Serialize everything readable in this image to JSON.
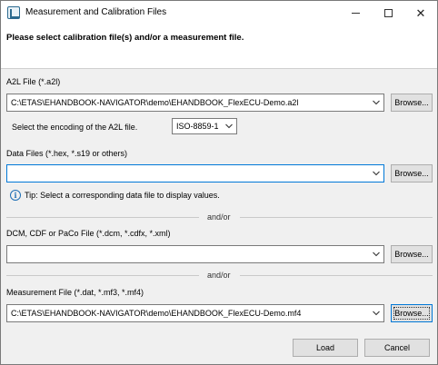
{
  "window": {
    "title": "Measurement and Calibration Files",
    "minimize_label": "",
    "maximize_label": "",
    "close_label": ""
  },
  "header": {
    "instruction": "Please select calibration file(s) and/or a measurement file."
  },
  "a2l": {
    "label": "A2L File (*.a2l)",
    "value": "C:\\ETAS\\EHANDBOOK-NAVIGATOR\\demo\\EHANDBOOK_FlexECU-Demo.a2l",
    "browse_label": "Browse...",
    "encoding_label": "Select the encoding of the A2L file.",
    "encoding_value": "ISO-8859-1"
  },
  "data_files": {
    "label": "Data Files (*.hex, *.s19 or others)",
    "value": "",
    "browse_label": "Browse...",
    "tip": "Tip: Select a corresponding data file to display values."
  },
  "separator_1": "and/or",
  "dcm": {
    "label": "DCM, CDF or PaCo File (*.dcm, *.cdfx, *.xml)",
    "value": "",
    "browse_label": "Browse..."
  },
  "separator_2": "and/or",
  "measurement": {
    "label": "Measurement File (*.dat, *.mf3, *.mf4)",
    "value": "C:\\ETAS\\EHANDBOOK-NAVIGATOR\\demo\\EHANDBOOK_FlexECU-Demo.mf4",
    "browse_label": "Browse..."
  },
  "actions": {
    "load_label": "Load",
    "cancel_label": "Cancel"
  },
  "icons": {
    "app": "app-icon",
    "info": "info-icon",
    "dropdown": "chevron-down-icon"
  },
  "colors": {
    "focus_border": "#0078d7",
    "info_blue": "#1f6fb5"
  }
}
